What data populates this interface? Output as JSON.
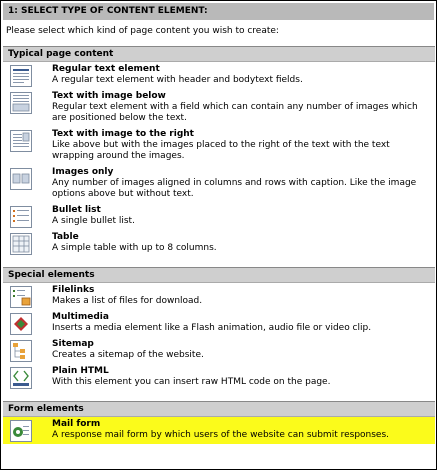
{
  "step": {
    "title": "1: SELECT TYPE OF CONTENT ELEMENT:"
  },
  "intro": "Please select which kind of page content you wish to create:",
  "groups": [
    {
      "title": "Typical page content",
      "items": [
        {
          "title": "Regular text element",
          "desc": "A regular text element with header and bodytext fields.",
          "icon": "text-icon"
        },
        {
          "title": "Text with image below",
          "desc": "Regular text element with a field which can contain any number of images which are positioned below the text.",
          "icon": "text-image-below-icon"
        },
        {
          "title": "Text with image to the right",
          "desc": "Like above but with the images placed to the right of the text with the text wrapping around the images.",
          "icon": "text-image-right-icon"
        },
        {
          "title": "Images only",
          "desc": "Any number of images aligned in columns and rows with caption. Like the image options above but without text.",
          "icon": "images-icon"
        },
        {
          "title": "Bullet list",
          "desc": "A single bullet list.",
          "icon": "bullet-list-icon"
        },
        {
          "title": "Table",
          "desc": "A simple table with up to 8 columns.",
          "icon": "table-icon"
        }
      ]
    },
    {
      "title": "Special elements",
      "items": [
        {
          "title": "Filelinks",
          "desc": "Makes a list of files for download.",
          "icon": "filelinks-icon"
        },
        {
          "title": "Multimedia",
          "desc": "Inserts a media element like a Flash animation, audio file or video clip.",
          "icon": "multimedia-icon"
        },
        {
          "title": "Sitemap",
          "desc": "Creates a sitemap of the website.",
          "icon": "sitemap-icon"
        },
        {
          "title": "Plain HTML",
          "desc": "With this element you can insert raw HTML code on the page.",
          "icon": "html-icon"
        }
      ]
    },
    {
      "title": "Form elements",
      "items": [
        {
          "title": "Mail form",
          "desc": "A response mail form by which users of the website can submit responses.",
          "icon": "mail-form-icon",
          "selected": true
        }
      ]
    }
  ],
  "colors": {
    "selected": "#fbfb1b",
    "group_header": "#cfcfcf",
    "step_header": "#b9b9b9"
  }
}
